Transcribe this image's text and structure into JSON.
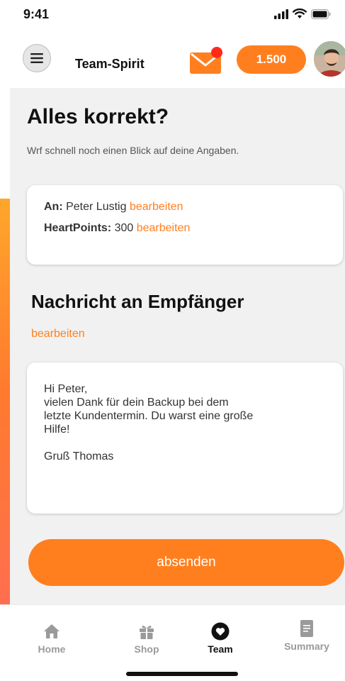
{
  "status": {
    "time": "9:41"
  },
  "header": {
    "title": "Team-Spirit",
    "coins": "1.500"
  },
  "page": {
    "title": "Alles korrekt?",
    "subtitle": "Wrf schnell noch einen Blick auf deine Angaben."
  },
  "summary": {
    "to_label": "An:",
    "to_value": "Peter Lustig",
    "points_label": "HeartPoints:",
    "points_value": "300",
    "edit_label": "bearbeiten"
  },
  "message": {
    "title": "Nachricht an Empfänger",
    "edit_label": "bearbeiten",
    "lines": [
      "Hi Peter,",
      "vielen Dank für dein Backup bei dem",
      "letzte Kundentermin. Du warst eine große",
      "Hilfe!",
      "",
      "Gruß Thomas"
    ]
  },
  "actions": {
    "send_label": "absenden"
  },
  "nav": {
    "items": [
      {
        "label": "Home",
        "icon": "home-icon"
      },
      {
        "label": "Shop",
        "icon": "gift-icon"
      },
      {
        "label": "Team",
        "icon": "heart-icon"
      },
      {
        "label": "Summary",
        "icon": "document-icon"
      }
    ],
    "active": "Team"
  },
  "colors": {
    "accent": "#ff7f1f",
    "badge": "#ff2a1a",
    "background": "#f1f1f1"
  }
}
